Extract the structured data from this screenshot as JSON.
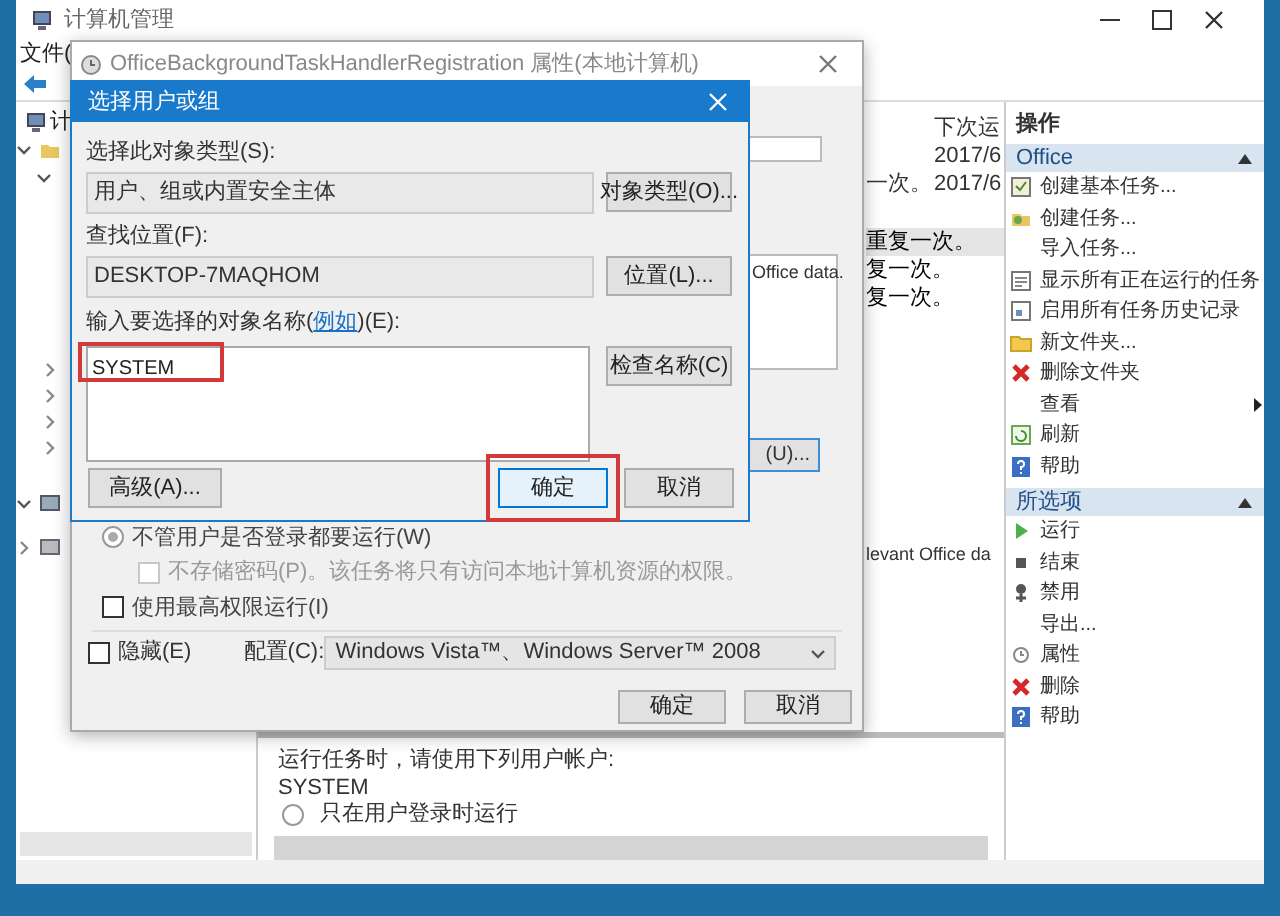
{
  "main_window": {
    "title": "计算机管理",
    "menu": [
      "文件("
    ],
    "tree": [
      {
        "label": "计"
      }
    ],
    "task_list": {
      "header": "下次运",
      "rows": [
        {
          "next_run": "2017/6"
        },
        {
          "trigger": "一次。",
          "next_run": "2017/6"
        }
      ]
    },
    "trigger_lines": [
      {
        "text": "重复一次。",
        "selected": true
      },
      {
        "text": "复一次。",
        "selected": false
      },
      {
        "text": "复一次。",
        "selected": false
      }
    ],
    "description_fragment": "levant Office da",
    "security_pane": {
      "label": "运行任务时，请使用下列用户帐户:",
      "account": "SYSTEM",
      "option": {
        "label": "只在用户登录时运行",
        "selected": false
      }
    },
    "actions": {
      "title": "操作",
      "sections": [
        {
          "title": "Office",
          "expanded": true,
          "items": [
            {
              "label": "创建基本任务...",
              "kind": "basic-task"
            },
            {
              "label": "创建任务...",
              "kind": "task"
            },
            {
              "label": "导入任务...",
              "kind": "plain"
            },
            {
              "label": "显示所有正在运行的任务",
              "kind": "running"
            },
            {
              "label": "启用所有任务历史记录",
              "kind": "history"
            },
            {
              "label": "新文件夹...",
              "kind": "folder"
            },
            {
              "label": "删除文件夹",
              "kind": "delete"
            },
            {
              "label": "查看",
              "kind": "plain",
              "submenu": true
            },
            {
              "label": "刷新",
              "kind": "refresh"
            },
            {
              "label": "帮助",
              "kind": "help"
            }
          ]
        },
        {
          "title": "所选项",
          "expanded": true,
          "items": [
            {
              "label": "运行",
              "kind": "run"
            },
            {
              "label": "结束",
              "kind": "stop"
            },
            {
              "label": "禁用",
              "kind": "disable"
            },
            {
              "label": "导出...",
              "kind": "plain"
            },
            {
              "label": "属性",
              "kind": "properties"
            },
            {
              "label": "删除",
              "kind": "delete"
            },
            {
              "label": "帮助",
              "kind": "help"
            }
          ]
        }
      ]
    }
  },
  "properties_dialog": {
    "title": "OfficeBackgroundTaskHandlerRegistration 属性(本地计算机)",
    "description_fragment": "Office data.",
    "change_user_button": "(U)...",
    "run_options": [
      {
        "kind": "radio",
        "label": "不管用户是否登录都要运行(W)",
        "selected": true,
        "disabled": false
      },
      {
        "kind": "checkbox",
        "label": "不存储密码(P)。该任务将只有访问本地计算机资源的权限。",
        "checked": false,
        "disabled": true
      },
      {
        "kind": "checkbox",
        "label": "使用最高权限运行(I)",
        "checked": false,
        "disabled": false
      }
    ],
    "hidden": {
      "label": "隐藏(E)",
      "checked": false
    },
    "configure": {
      "label": "配置(C):",
      "value": "Windows Vista™、Windows Server™ 2008"
    },
    "buttons": [
      "确定",
      "取消"
    ]
  },
  "select_dialog": {
    "title": "选择用户或组",
    "object_type": {
      "label": "选择此对象类型(S):",
      "value": "用户、组或内置安全主体",
      "button": "对象类型(O)..."
    },
    "location": {
      "label": "查找位置(F):",
      "value": "DESKTOP-7MAQHOM",
      "button": "位置(L)..."
    },
    "names": {
      "label_before": "输入要选择的对象名称(",
      "link": "例如",
      "label_after": ")(E):",
      "value": "SYSTEM",
      "highlighted": true,
      "button": "检查名称(C)"
    },
    "buttons": [
      {
        "label": "高级(A)...",
        "highlighted": false
      },
      {
        "label": "确定",
        "highlighted": true
      },
      {
        "label": "取消",
        "highlighted": false
      }
    ]
  }
}
